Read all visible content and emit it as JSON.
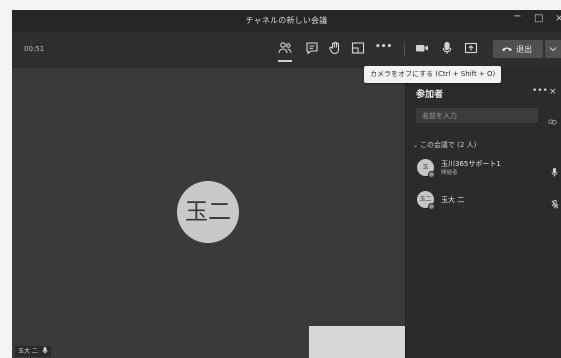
{
  "window": {
    "title": "チャネルの新しい会議",
    "controls": {
      "minimize": "−",
      "maximize": "□",
      "close": "×"
    }
  },
  "toolbar": {
    "timer": "00:51",
    "buttons": [
      {
        "name": "participants",
        "icon": "people-icon",
        "active": true
      },
      {
        "name": "chat",
        "icon": "chat-icon"
      },
      {
        "name": "raise-hand",
        "icon": "hand-icon"
      },
      {
        "name": "breakout-rooms",
        "icon": "rooms-icon"
      },
      {
        "name": "more",
        "icon": "more-icon",
        "label": "•••"
      },
      {
        "name": "camera",
        "icon": "camera-icon"
      },
      {
        "name": "mic",
        "icon": "mic-icon"
      },
      {
        "name": "share",
        "icon": "share-icon"
      }
    ],
    "leave_label": "退出"
  },
  "tooltip": {
    "text": "カメラをオフにする (Ctrl + Shift + O)"
  },
  "stage": {
    "main_avatar_initials": "玉二",
    "self_name_tag": "玉大 二"
  },
  "panel": {
    "title": "参加者",
    "more": "•••",
    "close": "×",
    "search_placeholder": "名前を入力",
    "section_header": "この会議で (2 人)",
    "participants": [
      {
        "initials": "玉",
        "name": "玉川365サポート1",
        "role": "開催者",
        "mic": "on"
      },
      {
        "initials": "玉二",
        "name": "玉大 二",
        "role": "",
        "mic": "muted"
      }
    ]
  },
  "colors": {
    "window_bg": "#3a3a3a",
    "titlebar": "#262626",
    "panel_bg": "#2b2b2b",
    "avatar": "#c9c9c9"
  }
}
